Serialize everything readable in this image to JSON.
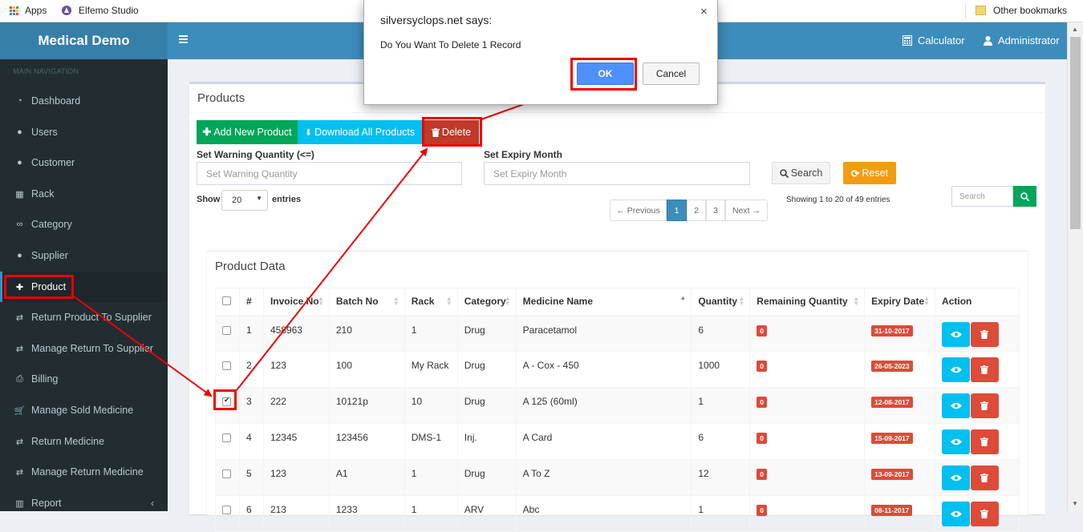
{
  "bookmarks": {
    "apps_label": "Apps",
    "studio_label": "Elfemo Studio",
    "other_label": "Other bookmarks"
  },
  "header": {
    "brand": "Medical Demo",
    "calculator": "Calculator",
    "user": "Administrator"
  },
  "sidebar": {
    "section": "MAIN NAVIGATION",
    "items": [
      {
        "label": "Dashboard",
        "icon": "dashboard-icon"
      },
      {
        "label": "Users",
        "icon": "user-icon"
      },
      {
        "label": "Customer",
        "icon": "user-icon"
      },
      {
        "label": "Rack",
        "icon": "table-icon"
      },
      {
        "label": "Category",
        "icon": "link-icon"
      },
      {
        "label": "Supplier",
        "icon": "user-icon"
      },
      {
        "label": "Product",
        "icon": "medkit-icon"
      },
      {
        "label": "Return Product To Supplier",
        "icon": "exchange-icon"
      },
      {
        "label": "Manage Return To Supplier",
        "icon": "exchange-icon"
      },
      {
        "label": "Billing",
        "icon": "print-icon"
      },
      {
        "label": "Manage Sold Medicine",
        "icon": "cart-icon"
      },
      {
        "label": "Return Medicine",
        "icon": "exchange-icon"
      },
      {
        "label": "Manage Return Medicine",
        "icon": "exchange-icon"
      },
      {
        "label": "Report",
        "icon": "chart-icon"
      }
    ],
    "active_index": 6
  },
  "products": {
    "title": "Products",
    "add_label": "Add New Product",
    "download_label": "Download All Products",
    "delete_label": "Delete",
    "warning_label": "Set Warning Quantity (<=)",
    "warning_placeholder": "Set Warning Quantity",
    "expiry_label": "Set Expiry Month",
    "expiry_placeholder": "Set Expiry Month",
    "search_label": "Search",
    "reset_label": "Reset",
    "show_label": "Show",
    "entries_value": "20",
    "entries_label": "entries",
    "info": "Showing 1 to 20 of 49 entries",
    "search_placeholder": "Search",
    "pagination": [
      "← Previous",
      "1",
      "2",
      "3",
      "Next →"
    ],
    "current_page": "1"
  },
  "product_data": {
    "title": "Product Data",
    "columns": [
      "#",
      "Invoice No",
      "Batch No",
      "Rack",
      "Category",
      "Medicine Name",
      "Quantity",
      "Remaining Quantity",
      "Expiry Date",
      "Action"
    ],
    "rows": [
      {
        "n": "1",
        "invoice": "458963",
        "batch": "210",
        "rack": "1",
        "category": "Drug",
        "medicine": "Paracetamol",
        "qty": "6",
        "remaining": "0",
        "expiry": "31-10-2017",
        "checked": false
      },
      {
        "n": "2",
        "invoice": "123",
        "batch": "100",
        "rack": "My Rack",
        "category": "Drug",
        "medicine": "A - Cox - 450",
        "qty": "1000",
        "remaining": "0",
        "expiry": "26-05-2023",
        "checked": false
      },
      {
        "n": "3",
        "invoice": "222",
        "batch": "10121p",
        "rack": "10",
        "category": "Drug",
        "medicine": "A 125 (60ml)",
        "qty": "1",
        "remaining": "0",
        "expiry": "12-08-2017",
        "checked": true
      },
      {
        "n": "4",
        "invoice": "12345",
        "batch": "123456",
        "rack": "DMS-1",
        "category": "Inj.",
        "medicine": "A Card",
        "qty": "6",
        "remaining": "0",
        "expiry": "15-09-2017",
        "checked": false
      },
      {
        "n": "5",
        "invoice": "123",
        "batch": "A1",
        "rack": "1",
        "category": "Drug",
        "medicine": "A To Z",
        "qty": "12",
        "remaining": "0",
        "expiry": "13-09-2017",
        "checked": false
      },
      {
        "n": "6",
        "invoice": "213",
        "batch": "1233",
        "rack": "1",
        "category": "ARV",
        "medicine": "Abc",
        "qty": "1",
        "remaining": "0",
        "expiry": "08-11-2017",
        "checked": false
      }
    ]
  },
  "dialog": {
    "title": "silversyclops.net says:",
    "message": "Do You Want To Delete 1 Record",
    "ok": "OK",
    "cancel": "Cancel"
  },
  "colors": {
    "brand": "#3c8dbc",
    "brand_dark": "#367fa9",
    "sidebar": "#222d32",
    "success": "#00a65a",
    "info": "#00c0ef",
    "danger": "#dd4b39",
    "warning": "#f39c12",
    "callout": "#e00000"
  }
}
